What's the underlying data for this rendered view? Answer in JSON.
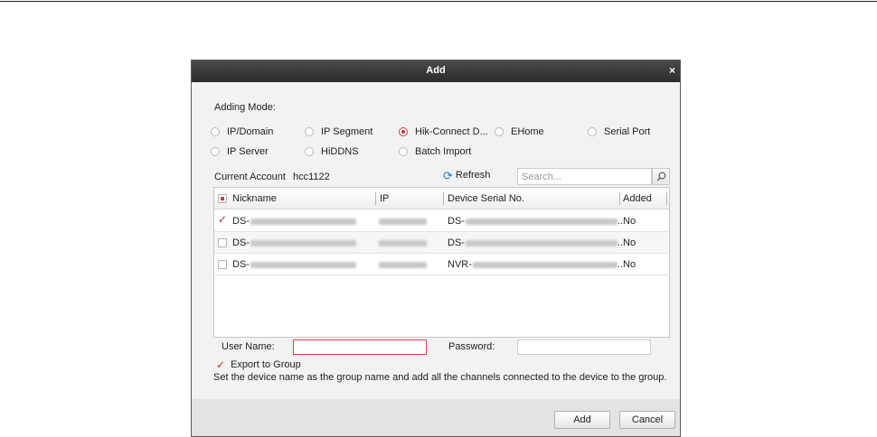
{
  "dialog": {
    "title": "Add",
    "close_glyph": "×",
    "adding_mode_label": "Adding Mode:",
    "modes": [
      {
        "label": "IP/Domain",
        "selected": false
      },
      {
        "label": "IP Segment",
        "selected": false
      },
      {
        "label": "Hik-Connect D...",
        "selected": true
      },
      {
        "label": "EHome",
        "selected": false
      },
      {
        "label": "Serial Port",
        "selected": false
      },
      {
        "label": "IP Server",
        "selected": false
      },
      {
        "label": "HiDDNS",
        "selected": false
      },
      {
        "label": "Batch Import",
        "selected": false
      }
    ],
    "current_account_label": "Current Account",
    "current_account_value": "hcc1122",
    "refresh_label": "Refresh",
    "search_placeholder": "Search...",
    "table": {
      "headers": [
        "Nickname",
        "IP",
        "Device Serial No.",
        "Added"
      ],
      "rows": [
        {
          "checked": true,
          "nickname_prefix": "DS-",
          "serial_prefix": "DS-",
          "added": "No"
        },
        {
          "checked": false,
          "nickname_prefix": "DS-",
          "serial_prefix": "DS-",
          "added": "No"
        },
        {
          "checked": false,
          "nickname_prefix": "DS-",
          "serial_prefix": "NVR-",
          "added": "No"
        }
      ]
    },
    "username_label": "User Name:",
    "username_value": "",
    "password_label": "Password:",
    "password_value": "",
    "export_label": "Export to Group",
    "export_checked": true,
    "hint": "Set the device name as the group name and add all the channels connected to the device to the group.",
    "add_button": "Add",
    "cancel_button": "Cancel"
  },
  "colors": {
    "accent": "#d32f2f",
    "refresh": "#2a78c6",
    "titlebar": "#333333"
  },
  "icons": {
    "close": "close-icon",
    "refresh": "refresh-icon",
    "search": "search-icon",
    "check": "checkmark-icon"
  }
}
